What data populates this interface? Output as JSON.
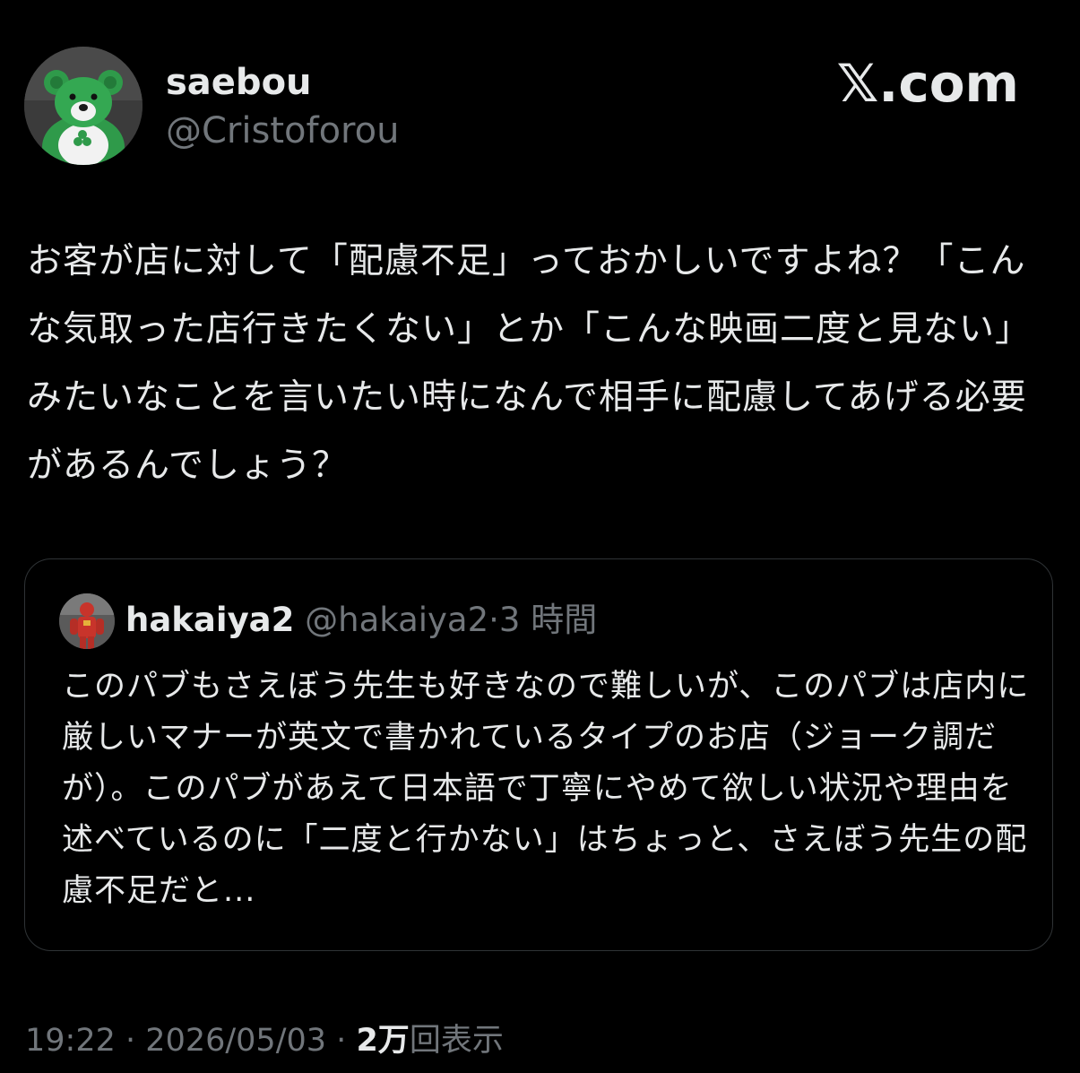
{
  "author": {
    "display_name": "saebou",
    "handle": "@Cristoforou",
    "avatar_icon": "green-teddy-bear-avatar"
  },
  "brand": {
    "logo_text": "𝕏.com"
  },
  "tweet": {
    "text": "お客が店に対して「配慮不足」っておかしいですよね？「こんな気取った店行きたくない」とか「こんな映画二度と見ない」みたいなことを言いたい時になんで相手に配慮してあげる必要があるんでしょう？"
  },
  "quote": {
    "display_name": "hakaiya2",
    "handle": "@hakaiya2",
    "separator": "·",
    "time": "3 時間",
    "avatar_icon": "red-figure-avatar",
    "text": "このパブもさえぼう先生も好きなので難しいが、このパブは店内に厳しいマナーが英文で書かれているタイプのお店（ジョーク調だが）。このパブがあえて日本語で丁寧にやめて欲しい状況や理由を述べているのに「二度と行かない」はちょっと、さえぼう先生の配慮不足だと..."
  },
  "footer": {
    "time": "19:22",
    "separator": "·",
    "date": "2026/05/03",
    "views_count": "2万",
    "views_label": "回表示"
  },
  "colors": {
    "background": "#000000",
    "primary_text": "#e7e9ea",
    "secondary_text": "#71767b",
    "border": "#2f3336"
  }
}
